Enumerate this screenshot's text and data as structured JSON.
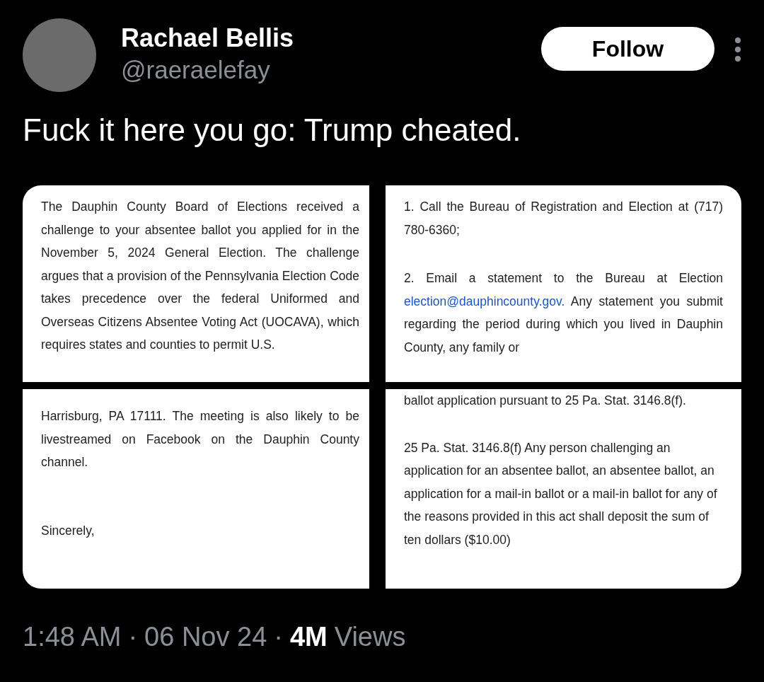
{
  "author": {
    "name": "Rachael Bellis",
    "handle": "@raeraelefay"
  },
  "follow_button": "Follow",
  "text": "Fuck it here you go: Trump cheated.",
  "left_panel": {
    "top": [
      "The Dauphin County Board of Elections received a challenge to your absentee ballot you applied for in the November 5, 2024 General Election. The challenge argues that a provision of the Pennsylvania Election Code takes precedence over the federal Uniformed and Overseas Citizens Absentee Voting Act (UOCAVA), which requires states and counties to permit U.S."
    ],
    "bottom": [
      "Harrisburg, PA 17111. The meeting is also likely to be livestreamed on Facebook on the Dauphin County channel.",
      "Sincerely,"
    ]
  },
  "right_panel": {
    "top": [
      {
        "before": "1. Call the Bureau of Registration and Election at (717) 780-6360;"
      },
      {
        "before": "2. Email a statement to the Bureau at Election",
        "link": "election@dauphincounty.gov.",
        "after": "Any statement you submit regarding the period during which you lived in Dauphin County, any family or"
      }
    ],
    "bottom": [
      "ballot application pursuant to 25 Pa. Stat. 3146.8(f).",
      "25 Pa. Stat. 3146.8(f) Any person challenging an application for an absentee ballot, an absentee ballot, an application for a mail-in ballot or a mail-in ballot for any of the reasons provided in this act shall deposit the sum of ten dollars ($10.00)"
    ]
  },
  "meta": {
    "time": "1:48 AM",
    "separators": [
      "·",
      "·"
    ],
    "date": "06 Nov 24",
    "views_count": "4M",
    "views_label": "Views"
  }
}
